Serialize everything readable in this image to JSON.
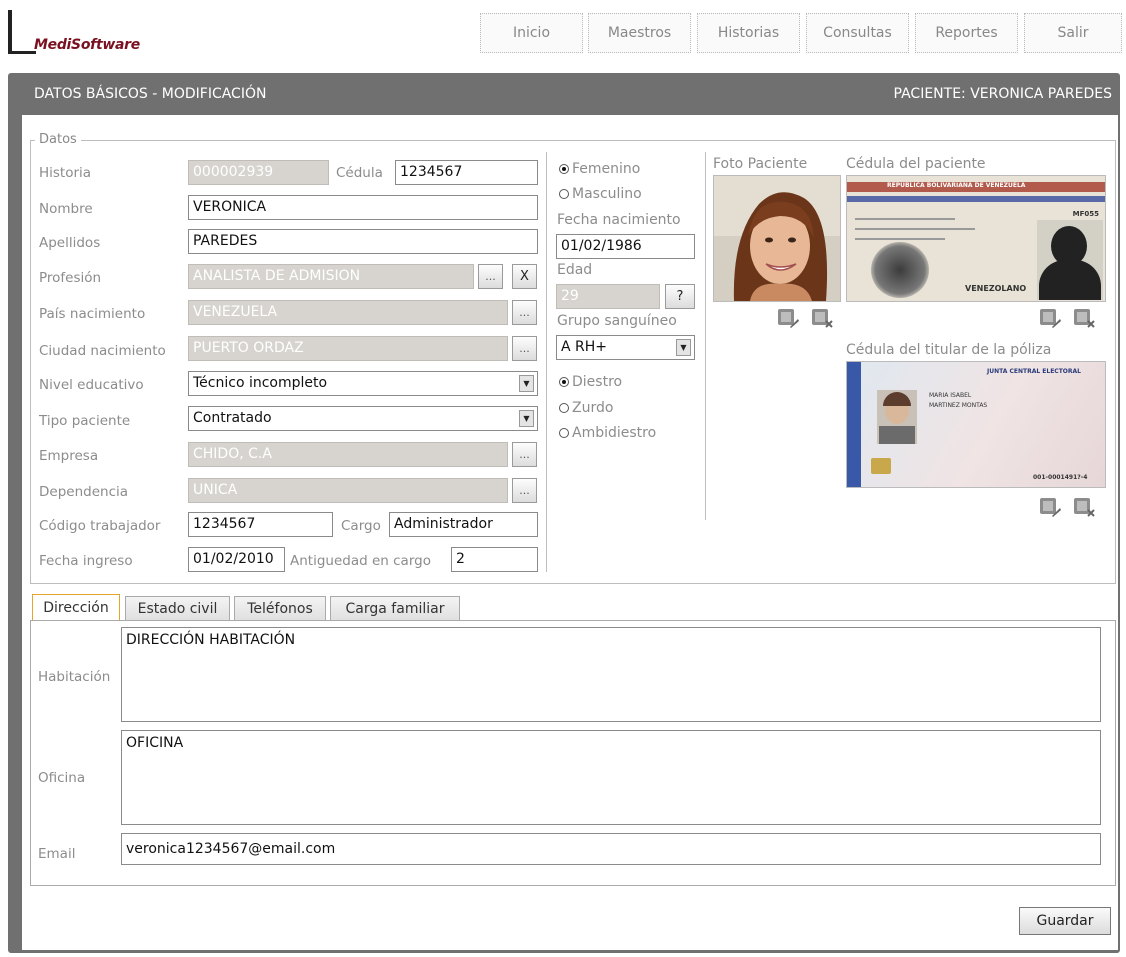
{
  "brand": {
    "logo_text": "MediSoftware"
  },
  "nav": [
    "Inicio",
    "Maestros",
    "Historias",
    "Consultas",
    "Reportes",
    "Salir"
  ],
  "header": {
    "title": "DATOS BÁSICOS - MODIFICACIÓN",
    "patient": "PACIENTE: VERONICA PAREDES"
  },
  "section": {
    "legend": "Datos"
  },
  "form": {
    "historia_label": "Historia",
    "historia_value": "000002939",
    "cedula_label": "Cédula",
    "cedula_value": "1234567",
    "nombre_label": "Nombre",
    "nombre_value": "VERONICA",
    "apellidos_label": "Apellidos",
    "apellidos_value": "PAREDES",
    "profesion_label": "Profesión",
    "profesion_value": "ANALISTA DE ADMISION",
    "pais_label": "País nacimiento",
    "pais_value": "VENEZUELA",
    "ciudad_label": "Ciudad nacimiento",
    "ciudad_value": "PUERTO ORDAZ",
    "nivel_label": "Nivel educativo",
    "nivel_value": "Técnico incompleto",
    "tipo_label": "Tipo paciente",
    "tipo_value": "Contratado",
    "empresa_label": "Empresa",
    "empresa_value": "CHIDO, C.A",
    "dependencia_label": "Dependencia",
    "dependencia_value": "UNICA",
    "codigo_label": "Código trabajador",
    "codigo_value": "1234567",
    "cargo_label": "Cargo",
    "cargo_value": "Administrador",
    "ingreso_label": "Fecha ingreso",
    "ingreso_value": "01/02/2010",
    "antiguedad_label": "Antiguedad en cargo",
    "antiguedad_value": "2",
    "browse_label": "...",
    "clear_label": "X",
    "age_help_label": "?"
  },
  "middle": {
    "sexo": [
      {
        "label": "Femenino",
        "checked": true
      },
      {
        "label": "Masculino",
        "checked": false
      }
    ],
    "fecha_nac_label": "Fecha nacimiento",
    "fecha_nac_value": "01/02/1986",
    "edad_label": "Edad",
    "edad_value": "29",
    "grupo_label": "Grupo sanguíneo",
    "grupo_value": "A RH+",
    "lateralidad": [
      {
        "label": "Diestro",
        "checked": true
      },
      {
        "label": "Zurdo",
        "checked": false
      },
      {
        "label": "Ambidiestro",
        "checked": false
      }
    ]
  },
  "photos": {
    "foto_label": "Foto Paciente",
    "cedula_label": "Cédula del paciente",
    "titular_label": "Cédula del titular de la póliza",
    "id1": {
      "heading": "REPUBLICA BOLIVARIANA DE VENEZUELA",
      "line": "VENEZOLANO",
      "code": "MF055"
    },
    "id2": {
      "heading": "JUNTA CENTRAL ELECTORAL",
      "name": "MARIA ISABEL",
      "surname": "MARTINEZ MONTAS",
      "number": "001-0001491?-4"
    }
  },
  "tabs": [
    "Dirección",
    "Estado civil",
    "Teléfonos",
    "Carga familiar"
  ],
  "direccion": {
    "habitacion_label": "Habitación",
    "habitacion_value": "DIRECCIÓN HABITACIÓN",
    "oficina_label": "Oficina",
    "oficina_value": "OFICINA",
    "email_label": "Email",
    "email_value": "veronica1234567@email.com"
  },
  "actions": {
    "save_label": "Guardar"
  },
  "colors": {
    "panel": "#707070",
    "disabled": "#d7d4cf",
    "tab_active_border": "#e5a52a",
    "brand": "#7a1020"
  }
}
